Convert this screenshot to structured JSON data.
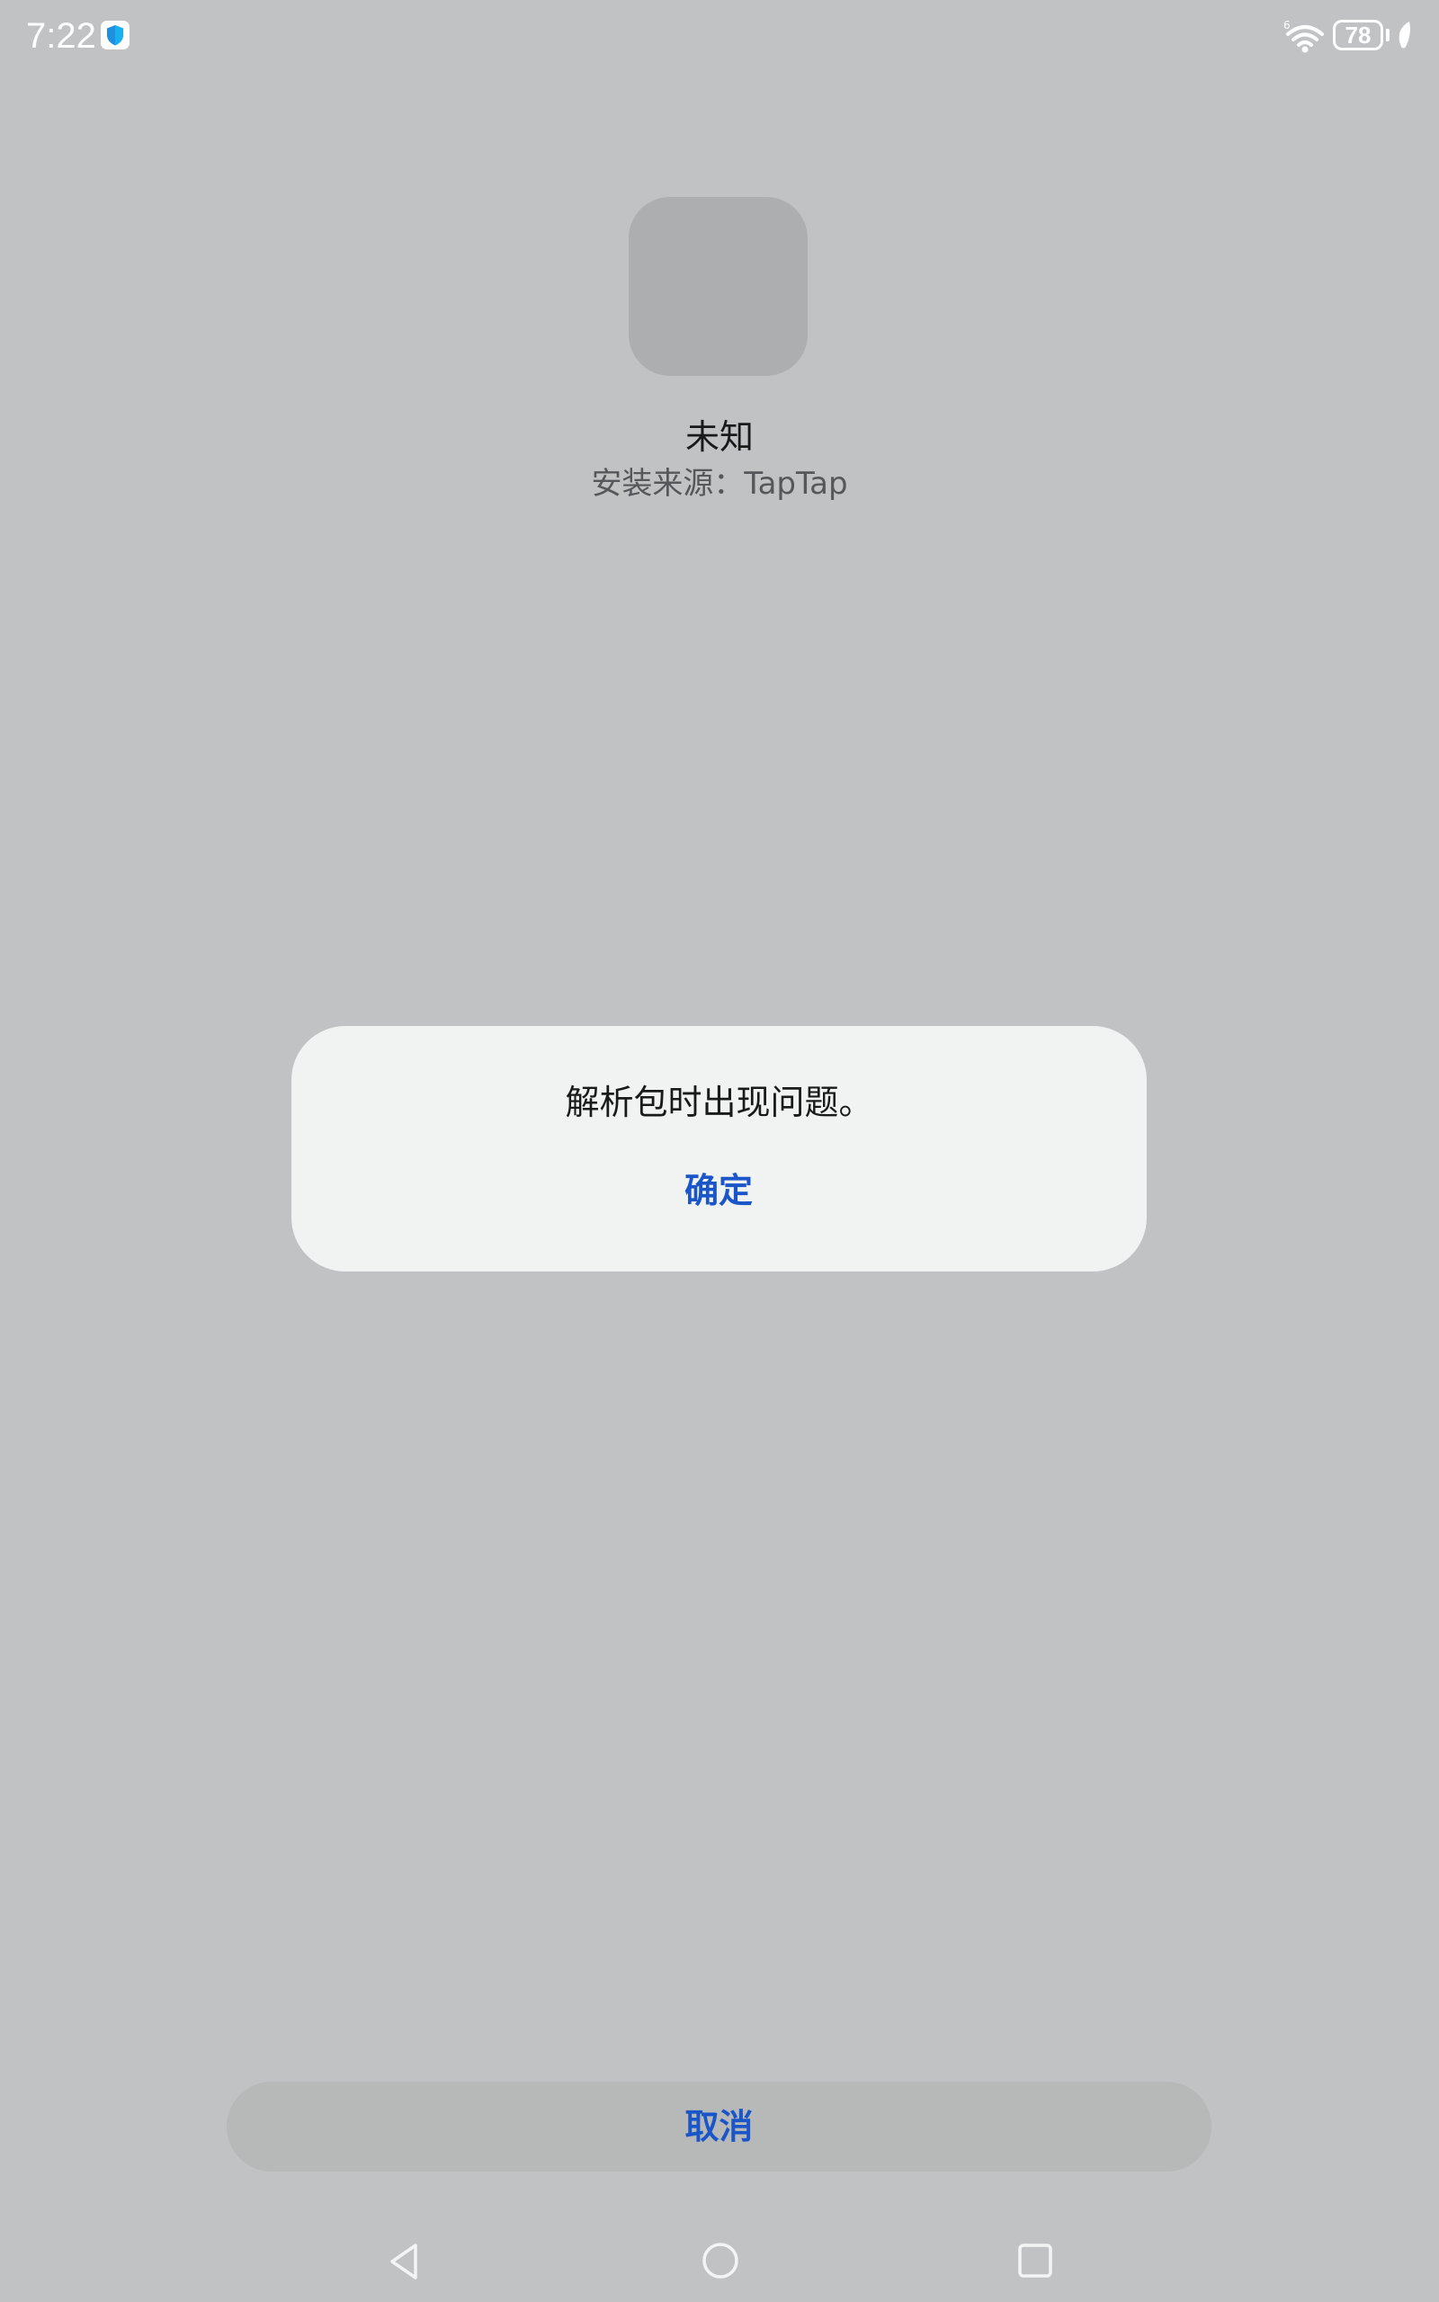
{
  "status_bar": {
    "time": "7:22",
    "battery_level": "78",
    "network_badge": "6"
  },
  "app_info": {
    "name": "未知",
    "install_source": "安装来源：TapTap"
  },
  "dialog": {
    "message": "解析包时出现问题。",
    "confirm_label": "确定"
  },
  "footer": {
    "cancel_label": "取消"
  },
  "colors": {
    "background": "#c1c2c4",
    "dialog_bg": "#f1f3f2",
    "accent": "#1a56c8",
    "cancel_bg": "#b7b8b8"
  }
}
